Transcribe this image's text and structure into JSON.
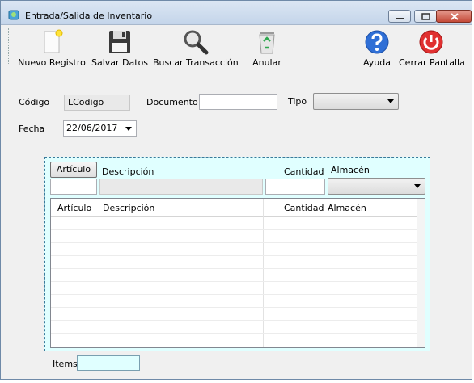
{
  "window": {
    "title": "Entrada/Salida de Inventario",
    "icon": "inventory-app-icon"
  },
  "toolbar": {
    "items": [
      {
        "label": "Nuevo Registro",
        "icon": "new-document-icon"
      },
      {
        "label": "Salvar Datos",
        "icon": "floppy-disk-icon"
      },
      {
        "label": "Buscar Transacción",
        "icon": "magnifier-icon"
      },
      {
        "label": "Anular",
        "icon": "recycle-bin-icon"
      },
      {
        "label": "Ayuda",
        "icon": "help-icon"
      },
      {
        "label": "Cerrar Pantalla",
        "icon": "power-icon"
      }
    ]
  },
  "form": {
    "codigo_label": "Código",
    "codigo_value": "LCodigo",
    "documento_label": "Documento",
    "documento_value": "",
    "tipo_label": "Tipo",
    "tipo_value": "",
    "fecha_label": "Fecha",
    "fecha_value": "22/06/2017"
  },
  "detail": {
    "articulo_button": "Artículo",
    "descripcion_label": "Descripción",
    "cantidad_label": "Cantidad",
    "almacen_label": "Almacén",
    "articulo_value": "",
    "descripcion_value": "",
    "cantidad_value": "",
    "almacen_value": ""
  },
  "grid": {
    "columns": [
      "Artículo",
      "Descripción",
      "Cantidad",
      "Almacén"
    ],
    "rows": []
  },
  "footer": {
    "items_label": "Items",
    "items_value": ""
  },
  "colors": {
    "panel_background": "#e0ffff",
    "items_box": "#e0ffff"
  }
}
